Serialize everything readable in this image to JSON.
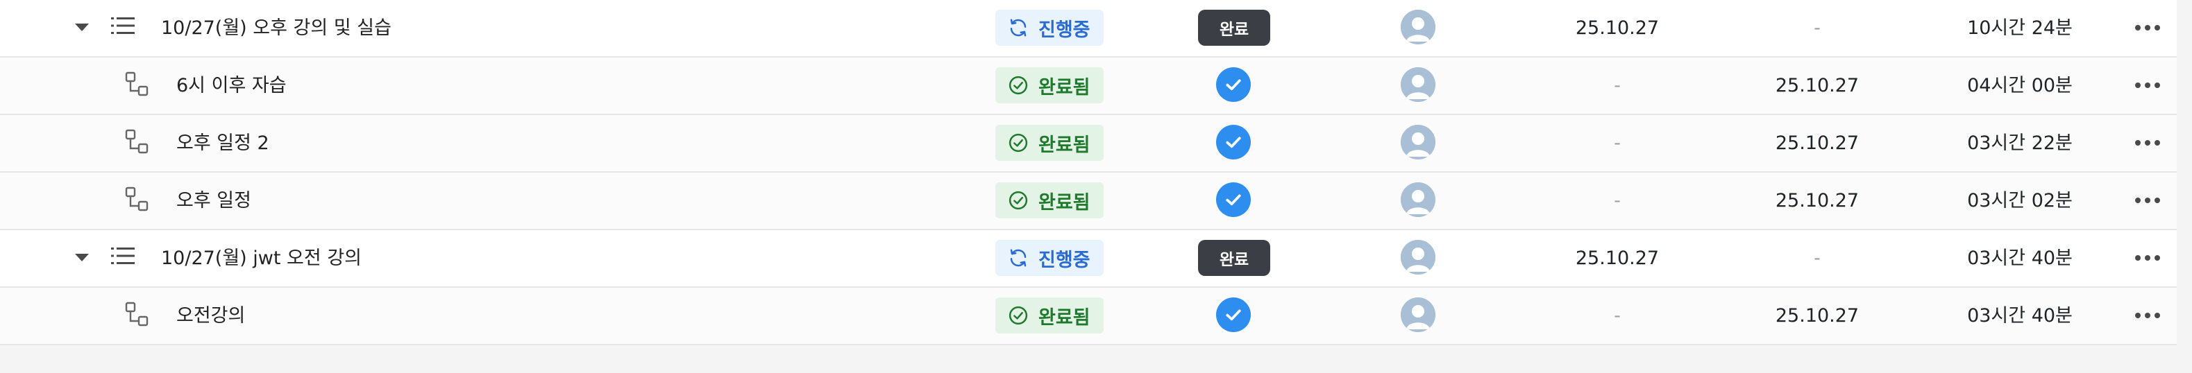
{
  "rows": [
    {
      "kind": "parent",
      "title": "10/27(월) 오후 강의 및 실습",
      "status": "진행중",
      "status_type": "progress",
      "completion": "완료",
      "start": "25.10.27",
      "end": "-",
      "duration": "10시간 24분"
    },
    {
      "kind": "child",
      "title": "6시 이후 자습",
      "status": "완료됨",
      "status_type": "done",
      "completion": "checked",
      "start": "-",
      "end": "25.10.27",
      "duration": "04시간 00분"
    },
    {
      "kind": "child",
      "title": "오후 일정 2",
      "status": "완료됨",
      "status_type": "done",
      "completion": "checked",
      "start": "-",
      "end": "25.10.27",
      "duration": "03시간 22분"
    },
    {
      "kind": "child",
      "title": "오후 일정",
      "status": "완료됨",
      "status_type": "done",
      "completion": "checked",
      "start": "-",
      "end": "25.10.27",
      "duration": "03시간 02분"
    },
    {
      "kind": "parent",
      "title": "10/27(월) jwt 오전 강의",
      "status": "진행중",
      "status_type": "progress",
      "completion": "완료",
      "start": "25.10.27",
      "end": "-",
      "duration": "03시간 40분"
    },
    {
      "kind": "child",
      "title": "오전강의",
      "status": "완료됨",
      "status_type": "done",
      "completion": "checked",
      "start": "-",
      "end": "25.10.27",
      "duration": "03시간 40분"
    }
  ],
  "colors": {
    "progress_bg": "#e8f3fd",
    "progress_fg": "#2a6bd1",
    "done_bg": "#e3f3e5",
    "done_fg": "#1f7a2e",
    "check_blue": "#2d8ef0",
    "complete_badge": "#3b3f45"
  },
  "icons": {
    "expand": "caret-down-icon",
    "parent_task": "list-icon",
    "sub_task": "subtask-icon",
    "status_progress": "refresh-icon",
    "status_done": "check-circle-icon",
    "assignee": "user-avatar-icon",
    "actions": "more-horizontal-icon"
  }
}
